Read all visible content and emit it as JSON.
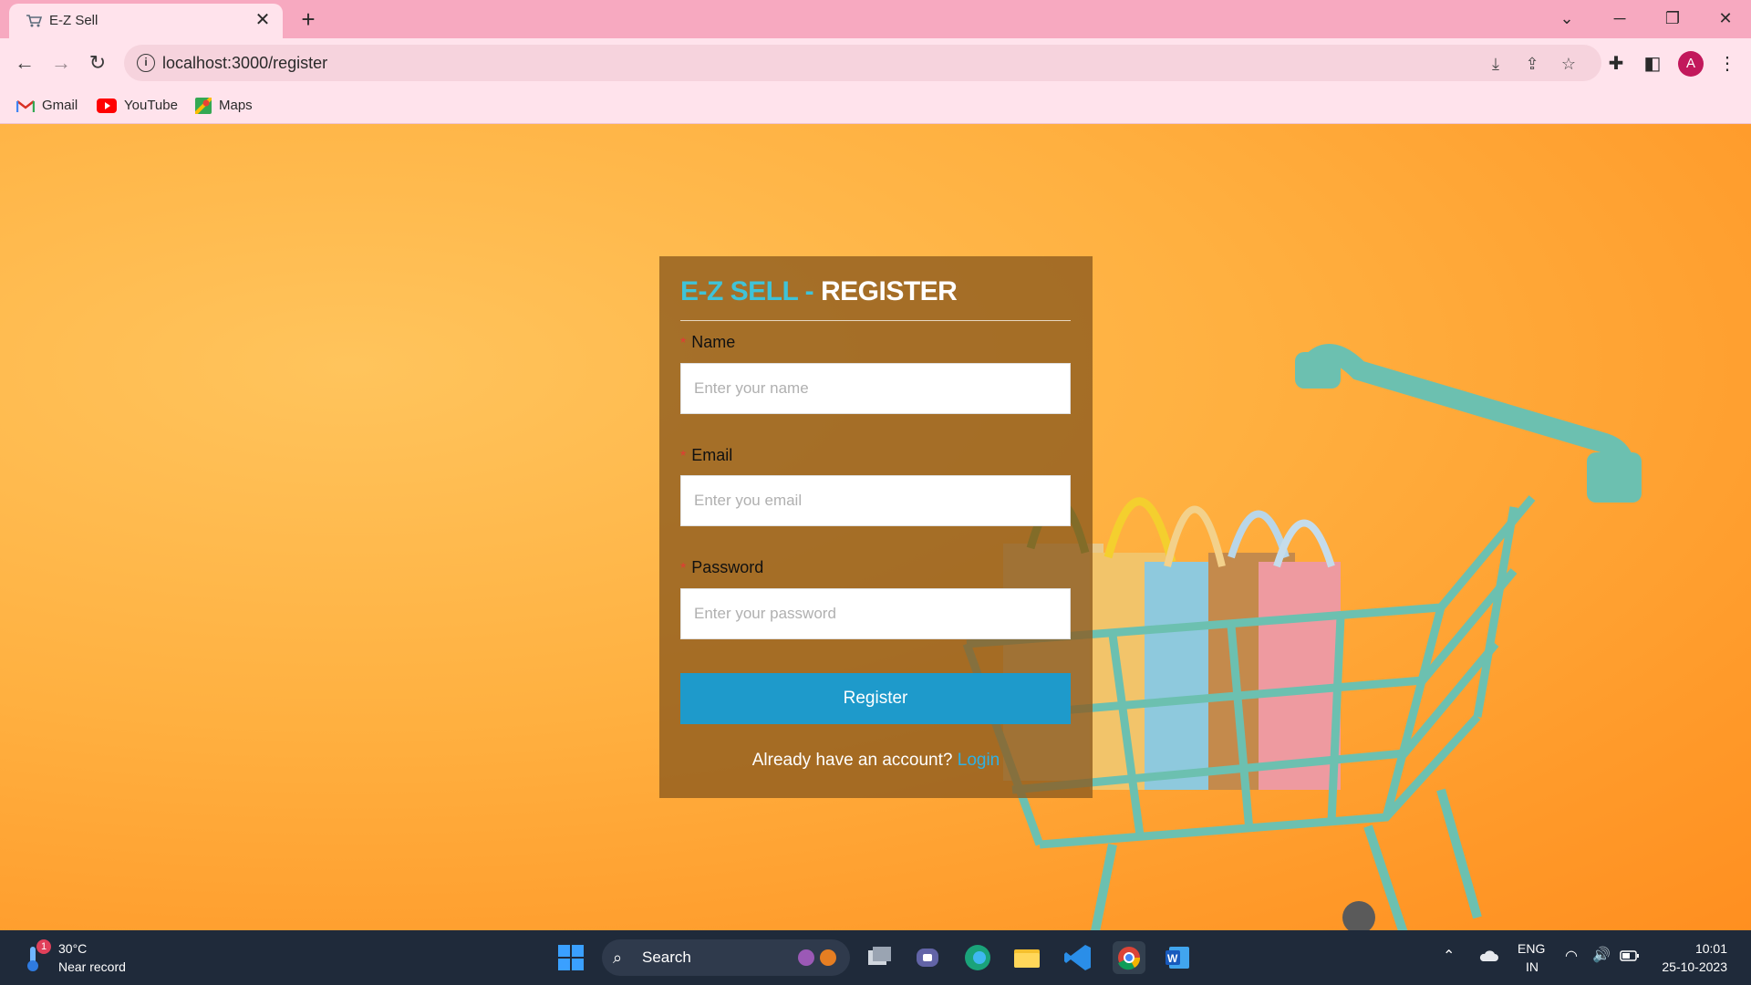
{
  "browser": {
    "tab_title": "E-Z Sell",
    "tab_close": "✕",
    "new_tab": "+",
    "url": "localhost:3000/register",
    "profile_initial": "A",
    "bookmarks": [
      {
        "label": "Gmail",
        "icon": "gmail-icon"
      },
      {
        "label": "YouTube",
        "icon": "youtube-icon"
      },
      {
        "label": "Maps",
        "icon": "maps-icon"
      }
    ]
  },
  "form": {
    "brand": "E-Z SELL -",
    "title": "REGISTER",
    "required_mark": "*",
    "fields": [
      {
        "label": "Name",
        "placeholder": "Enter your name",
        "value": ""
      },
      {
        "label": "Email",
        "placeholder": "Enter you email",
        "value": ""
      },
      {
        "label": "Password",
        "placeholder": "Enter your password",
        "value": ""
      }
    ],
    "submit_label": "Register",
    "login_prompt": "Already have an account?",
    "login_link": "Login"
  },
  "taskbar": {
    "weather_badge": "1",
    "temperature": "30°C",
    "weather_desc": "Near record",
    "search_label": "Search",
    "language": "ENG",
    "region": "IN",
    "time": "10:01",
    "date": "25-10-2023"
  },
  "colors": {
    "brand_accent": "#3fc3d8",
    "button": "#1e9acb",
    "tab_bar": "#f7a9c0",
    "page_bg": "#ffb040"
  }
}
